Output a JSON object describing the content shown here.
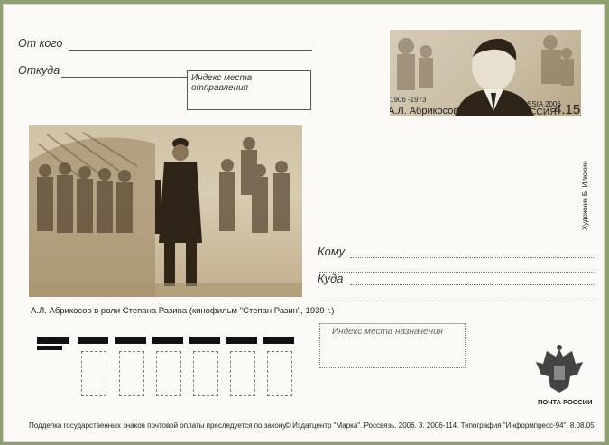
{
  "sender": {
    "from_label": "От кого",
    "address_label": "Откуда",
    "index_label": "Индекс места отправления"
  },
  "stamp": {
    "years": "1906 -1973",
    "name": "А.Л. Абрикосов",
    "country_small": "ROSSIA 2006",
    "country": "РОССИЯ",
    "value": "4.15"
  },
  "illustration": {
    "caption": "А.Л. Абрикосов в роли Степана Разина (кинофильм \"Степан Разин\", 1939 г.)"
  },
  "recipient": {
    "to_label": "Кому",
    "address_label": "Куда",
    "index_label": "Индекс места назначения"
  },
  "artist": "Художник Б. Илюхин",
  "emblem_label": "ПОЧТА РОССИИ",
  "footer": {
    "left": "Подделка государственных знаков почтовой оплаты преследуется по закону",
    "right": "© Издатцентр \"Марка\". Россвязь. 2006. 3. 2006-114. Типография \"Информпресс-94\".  8.08.05."
  },
  "colors": {
    "background": "#8fa070",
    "card": "#fbfaf6",
    "sepia": "#c2b08e"
  }
}
